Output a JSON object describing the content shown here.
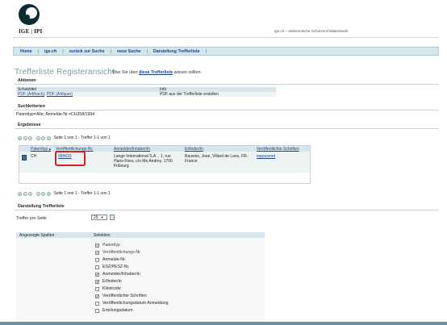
{
  "header": {
    "logo_text": "IGE | IPI",
    "site_subtitle": "ige.ch – elektronische Schutzrechtdatenbank"
  },
  "nav": {
    "items": [
      "Home",
      "ige.ch",
      "zurück zur Suche",
      "neue Suche",
      "Darstellung Trefferliste"
    ],
    "separator": "|"
  },
  "title": {
    "main": "Trefferliste Registeransicht",
    "hint_prefix": "Was Sie über ",
    "hint_link": "diese Trefferliste",
    "hint_suffix": " wissen sollten."
  },
  "aktionen": {
    "heading": "Aktionen",
    "col1_header": "Schutztitel",
    "col2_header": "Info",
    "link_hoch": "PDF (A4/hoch)",
    "link_sep": ", ",
    "link_quer": "PDF (A4/quer)",
    "info": "PDF aus der Trefferliste erstellen"
  },
  "suchkriterien": {
    "heading": "Suchkriterien",
    "text": "Patenttyp=Alle; Anmelde-Nr.=CH358/1994"
  },
  "ergebnisse": {
    "heading": "Ergebnisse",
    "pager_text": "Seite 1 von 1 - Treffer 1-1 von 1",
    "columns": [
      "Patenttyp ▴",
      "Veröffentlichungs-Nr.",
      "Anmelder/Inhaber/in",
      "Erfinder/in",
      "Veröffentlichte Schriften"
    ],
    "row": {
      "patenttyp": "CH",
      "nr": "689633",
      "anmelder": "Lange International S.A. , 1, rue Hans-Fries, c/o Me Andrey, 1700 Fribourg",
      "erfinder": "Bauvois, Jean, Villard de Lans, FR-France",
      "schriften": "espacenet"
    }
  },
  "darstellung": {
    "heading": "Darstellung Trefferliste",
    "treffer_label": "Treffer pro Seite",
    "treffer_value": "25",
    "spalten_label": "Angezeigte Spalten",
    "selektion_label": "Selektion",
    "options": [
      {
        "label": "Patenttyp",
        "checked": true,
        "disabled": true
      },
      {
        "label": "Veröffentlichungs-Nr.",
        "checked": true,
        "disabled": true
      },
      {
        "label": "Anmelde-Nr.",
        "checked": false,
        "disabled": false
      },
      {
        "label": "ESZ/PESZ-Nr.",
        "checked": false,
        "disabled": false
      },
      {
        "label": "Anmelder/Inhaber/in",
        "checked": true,
        "disabled": false
      },
      {
        "label": "Erfinder/in",
        "checked": true,
        "disabled": false
      },
      {
        "label": "Klindcode",
        "checked": false,
        "disabled": false
      },
      {
        "label": "Veröffentlichte Schriften",
        "checked": true,
        "disabled": false
      },
      {
        "label": "Veröffentlichungsdatum Anmeldung",
        "checked": false,
        "disabled": false
      },
      {
        "label": "Erteilungsdatum",
        "checked": false,
        "disabled": false
      }
    ]
  },
  "colors": {
    "accent": "#d6e6ea",
    "link": "#1a3e8a",
    "highlight": "#d51f1f",
    "title": "#7a9aa3"
  }
}
